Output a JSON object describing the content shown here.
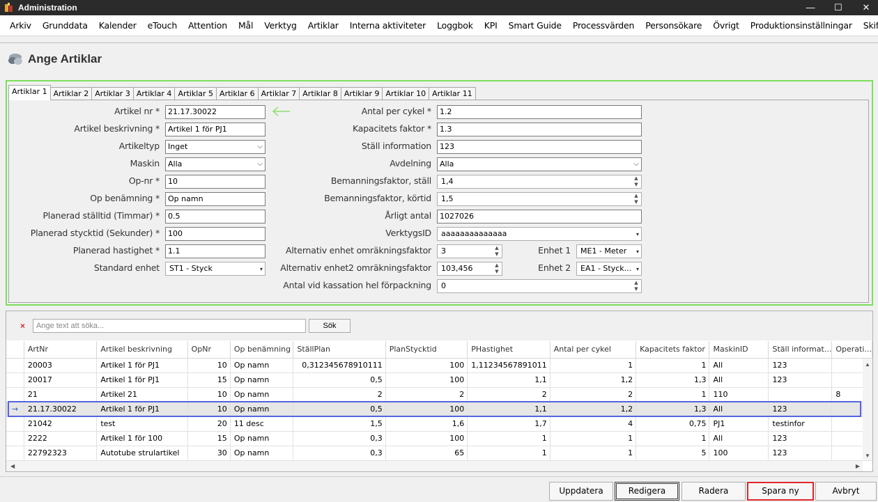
{
  "window": {
    "title": "Administration"
  },
  "menu": [
    "Arkiv",
    "Grunddata",
    "Kalender",
    "eTouch",
    "Attention",
    "Mål",
    "Verktyg",
    "Artiklar",
    "Interna aktiviteter",
    "Loggbok",
    "KPI",
    "Smart Guide",
    "Processvärden",
    "Personsökare",
    "Övrigt",
    "Produktionsinställningar",
    "Skiftöverlämning"
  ],
  "page": {
    "title": "Ange Artiklar"
  },
  "tabs": [
    "Artiklar 1",
    "Artiklar 2",
    "Artiklar 3",
    "Artiklar 4",
    "Artiklar 5",
    "Artiklar 6",
    "Artiklar 7",
    "Artiklar 8",
    "Artiklar 9",
    "Artiklar 10",
    "Artiklar 11"
  ],
  "form": {
    "artikel_nr": {
      "label": "Artikel nr *",
      "value": "21.17.30022"
    },
    "artikel_beskrivning": {
      "label": "Artikel beskrivning *",
      "value": "Artikel 1  för PJ1"
    },
    "artikeltyp": {
      "label": "Artikeltyp",
      "value": "Inget"
    },
    "maskin": {
      "label": "Maskin",
      "value": "Alla"
    },
    "op_nr": {
      "label": "Op-nr *",
      "value": "10"
    },
    "op_benamning": {
      "label": "Op benämning *",
      "value": "Op namn"
    },
    "planerad_stalltid": {
      "label": "Planerad ställtid (Timmar) *",
      "value": "0.5"
    },
    "planerad_stycktid": {
      "label": "Planerad stycktid (Sekunder) *",
      "value": "100"
    },
    "planerad_hastighet": {
      "label": "Planerad hastighet *",
      "value": "1.1"
    },
    "standard_enhet": {
      "label": "Standard enhet",
      "value": "ST1 - Styck"
    },
    "antal_per_cykel": {
      "label": "Antal per cykel *",
      "value": "1.2"
    },
    "kapacitets_faktor": {
      "label": "Kapacitets faktor *",
      "value": "1.3"
    },
    "stall_information": {
      "label": "Ställ information",
      "value": "123"
    },
    "avdelning": {
      "label": "Avdelning",
      "value": "Alla"
    },
    "bemanningsfaktor_stall": {
      "label": "Bemanningsfaktor, ställ",
      "value": "1,4"
    },
    "bemanningsfaktor_kortid": {
      "label": "Bemanningsfaktor, körtid",
      "value": "1,5"
    },
    "arligt_antal": {
      "label": "Årligt antal",
      "value": "1027026"
    },
    "verktygs_id": {
      "label": "VerktygsID",
      "value": "aaaaaaaaaaaaaa"
    },
    "alt_enhet_faktor": {
      "label": "Alternativ enhet omräkningsfaktor",
      "value": "3"
    },
    "alt_enhet2_faktor": {
      "label": "Alternativ enhet2 omräkningsfaktor",
      "value": "103,456"
    },
    "enhet1": {
      "label": "Enhet 1",
      "value": "ME1 - Meter"
    },
    "enhet2": {
      "label": "Enhet 2",
      "value": "EA1 - Styck..."
    },
    "antal_kassation": {
      "label": "Antal vid kassation hel förpackning",
      "value": "0"
    }
  },
  "search": {
    "placeholder": "Ange text att söka...",
    "button": "Sök"
  },
  "grid": {
    "columns": [
      "ArtNr",
      "Artikel beskrivning",
      "OpNr",
      "Op benämning",
      "StällPlan",
      "PlanStycktid",
      "PHastighet",
      "Antal per cykel",
      "Kapacitets faktor",
      "MaskinID",
      "Ställ informat...",
      "Operati..."
    ],
    "rows": [
      [
        "20003",
        "Artikel 1  för PJ1",
        "10",
        "Op namn",
        "0,312345678910111",
        "100",
        "1,11234567891011",
        "1",
        "1",
        "All",
        "123",
        ""
      ],
      [
        "20017",
        "Artikel 1  för PJ1",
        "15",
        "Op namn",
        "0,5",
        "100",
        "1,1",
        "1,2",
        "1,3",
        "All",
        "123",
        ""
      ],
      [
        "21",
        "Artikel 21",
        "10",
        "Op namn",
        "2",
        "2",
        "2",
        "2",
        "1",
        "110",
        "",
        "8"
      ],
      [
        "21.17.30022",
        "Artikel 1  för PJ1",
        "10",
        "Op namn",
        "0,5",
        "100",
        "1,1",
        "1,2",
        "1,3",
        "All",
        "123",
        ""
      ],
      [
        "21042",
        "test",
        "20",
        "11 desc",
        "1,5",
        "1,6",
        "1,7",
        "4",
        "0,75",
        "PJ1",
        "testinfor",
        ""
      ],
      [
        "2222",
        "Artikel 1 för 100",
        "15",
        "Op namn",
        "0,3",
        "100",
        "1",
        "1",
        "1",
        "All",
        "123",
        ""
      ],
      [
        "22792323",
        "Autotube strulartikel",
        "30",
        "Op namn",
        "0,3",
        "65",
        "1",
        "1",
        "5",
        "100",
        "123",
        ""
      ]
    ],
    "selected_row_indicator": "→"
  },
  "footer": {
    "update": "Uppdatera",
    "edit": "Redigera",
    "delete": "Radera",
    "save_new": "Spara ny",
    "cancel": "Avbryt"
  }
}
